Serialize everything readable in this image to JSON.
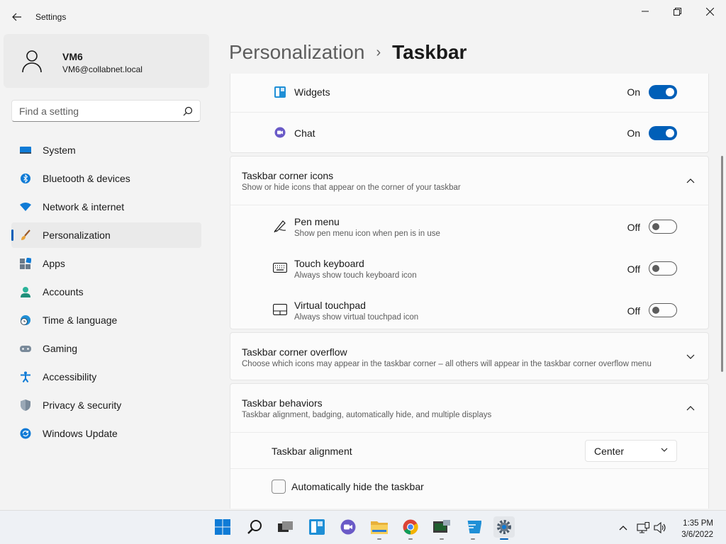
{
  "window": {
    "title": "Settings"
  },
  "user": {
    "name": "VM6",
    "email": "VM6@collabnet.local"
  },
  "search": {
    "placeholder": "Find a setting"
  },
  "sidebar": {
    "items": [
      {
        "label": "System",
        "icon": "system-icon"
      },
      {
        "label": "Bluetooth & devices",
        "icon": "bluetooth-icon"
      },
      {
        "label": "Network & internet",
        "icon": "wifi-icon"
      },
      {
        "label": "Personalization",
        "icon": "brush-icon",
        "active": true
      },
      {
        "label": "Apps",
        "icon": "apps-icon"
      },
      {
        "label": "Accounts",
        "icon": "accounts-icon"
      },
      {
        "label": "Time & language",
        "icon": "clock-globe-icon"
      },
      {
        "label": "Gaming",
        "icon": "gamepad-icon"
      },
      {
        "label": "Accessibility",
        "icon": "accessibility-icon"
      },
      {
        "label": "Privacy & security",
        "icon": "shield-icon"
      },
      {
        "label": "Windows Update",
        "icon": "update-icon"
      }
    ]
  },
  "breadcrumb": {
    "parent": "Personalization",
    "separator": "›",
    "current": "Taskbar"
  },
  "taskbar_items": {
    "widgets": {
      "label": "Widgets",
      "state": "On"
    },
    "chat": {
      "label": "Chat",
      "state": "On"
    }
  },
  "corner_icons": {
    "title": "Taskbar corner icons",
    "description": "Show or hide icons that appear on the corner of your taskbar",
    "items": [
      {
        "label": "Pen menu",
        "description": "Show pen menu icon when pen is in use",
        "state": "Off"
      },
      {
        "label": "Touch keyboard",
        "description": "Always show touch keyboard icon",
        "state": "Off"
      },
      {
        "label": "Virtual touchpad",
        "description": "Always show virtual touchpad icon",
        "state": "Off"
      }
    ]
  },
  "corner_overflow": {
    "title": "Taskbar corner overflow",
    "description": "Choose which icons may appear in the taskbar corner – all others will appear in the taskbar corner overflow menu"
  },
  "behaviors": {
    "title": "Taskbar behaviors",
    "description": "Taskbar alignment, badging, automatically hide, and multiple displays",
    "alignment_label": "Taskbar alignment",
    "alignment_value": "Center",
    "autohide_label": "Automatically hide the taskbar"
  },
  "system_taskbar": {
    "time": "1:35 PM",
    "date": "3/6/2022"
  },
  "colors": {
    "accent": "#005fb8",
    "background": "#f3f3f3",
    "card": "#fbfbfb"
  }
}
